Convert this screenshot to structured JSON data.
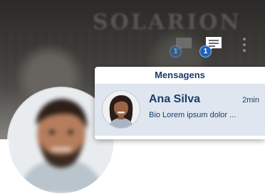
{
  "banner": {
    "text": "SOLARION"
  },
  "popup": {
    "title": "Mensagens",
    "messages": [
      {
        "name": "Ana Silva",
        "time": "2min",
        "snippet": "Bio Lorem ipsum dolor ..."
      }
    ]
  },
  "notifications": {
    "chat_inactive_count": "1",
    "chat_active_count": "1"
  },
  "colors": {
    "brand_blue": "#1a3d6a",
    "badge_blue": "#1f63b7",
    "selected_row": "#dfe6ef"
  }
}
